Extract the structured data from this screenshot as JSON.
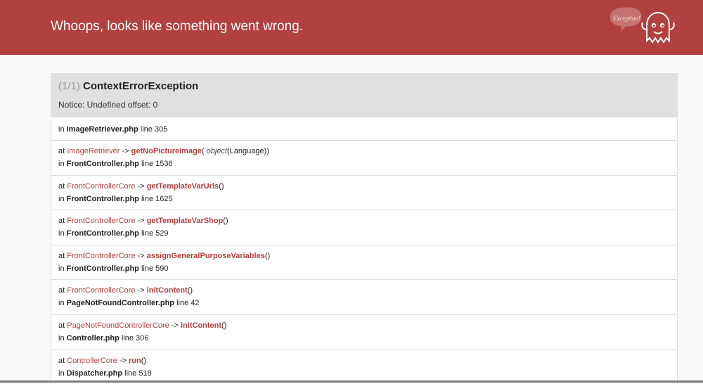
{
  "header": {
    "title": "Whoops, looks like something went wrong.",
    "mascot_text": "Exception!"
  },
  "exception": {
    "count": "(1/1)",
    "class": "ContextErrorException",
    "message": "Notice: Undefined offset: 0"
  },
  "trace": [
    {
      "at": "",
      "arrow": "",
      "method": "",
      "args_open": "",
      "arg_type": "",
      "arg_value": "",
      "args_close": "",
      "in": "in",
      "file": "ImageRetriever.php",
      "line": "line 305"
    },
    {
      "at": "at",
      "class": "ImageRetriever",
      "arrow": "->",
      "method": "getNoPictureImage",
      "args_open": "(",
      "arg_type": "object",
      "arg_value": "(Language)",
      "args_close": ")",
      "in": "in",
      "file": "FrontController.php",
      "line": "line 1536"
    },
    {
      "at": "at",
      "class": "FrontControllerCore",
      "arrow": "->",
      "method": "getTemplateVarUrls",
      "args_open": "(",
      "arg_type": "",
      "arg_value": "",
      "args_close": ")",
      "in": "in",
      "file": "FrontController.php",
      "line": "line 1625"
    },
    {
      "at": "at",
      "class": "FrontControllerCore",
      "arrow": "->",
      "method": "getTemplateVarShop",
      "args_open": "(",
      "arg_type": "",
      "arg_value": "",
      "args_close": ")",
      "in": "in",
      "file": "FrontController.php",
      "line": "line 529"
    },
    {
      "at": "at",
      "class": "FrontControllerCore",
      "arrow": "->",
      "method": "assignGeneralPurposeVariables",
      "args_open": "(",
      "arg_type": "",
      "arg_value": "",
      "args_close": ")",
      "in": "in",
      "file": "FrontController.php",
      "line": "line 590"
    },
    {
      "at": "at",
      "class": "FrontControllerCore",
      "arrow": "->",
      "method": "initContent",
      "args_open": "(",
      "arg_type": "",
      "arg_value": "",
      "args_close": ")",
      "in": "in",
      "file": "PageNotFoundController.php",
      "line": "line 42"
    },
    {
      "at": "at",
      "class": "PageNotFoundControllerCore",
      "arrow": "->",
      "method": "initContent",
      "args_open": "(",
      "arg_type": "",
      "arg_value": "",
      "args_close": ")",
      "in": "in",
      "file": "Controller.php",
      "line": "line 306"
    },
    {
      "at": "at",
      "class": "ControllerCore",
      "arrow": "->",
      "method": "run",
      "args_open": "(",
      "arg_type": "",
      "arg_value": "",
      "args_close": ")",
      "in": "in",
      "file": "Dispatcher.php",
      "line": "line 518"
    }
  ],
  "colors": {
    "header_bg": "#b0413e",
    "accent": "#b0413e",
    "panel_head_bg": "#e0e0e0",
    "page_bg": "#f9f9f9"
  }
}
